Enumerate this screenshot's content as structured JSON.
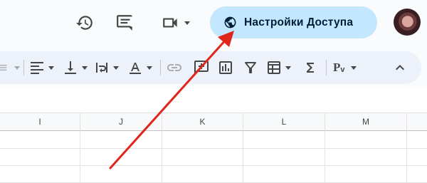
{
  "header": {
    "share_label": "Настройки Доступа"
  },
  "icons": {
    "history": "history-icon",
    "comments": "comment-icon",
    "meet": "video-camera-icon",
    "share": "globe-icon"
  },
  "toolbar": {
    "currency_label": "Р"
  },
  "columns": [
    "I",
    "J",
    "K",
    "L",
    "M"
  ],
  "colors": {
    "share_button_bg": "#c2e7ff",
    "toolbar_bg": "#edf2fa",
    "annotation_arrow": "#e0251b"
  }
}
